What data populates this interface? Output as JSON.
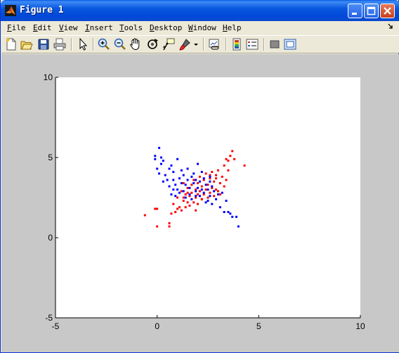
{
  "window": {
    "title": "Figure 1"
  },
  "menu": {
    "items": [
      {
        "label": "File",
        "u": "F",
        "rest": "ile"
      },
      {
        "label": "Edit",
        "u": "E",
        "rest": "dit"
      },
      {
        "label": "View",
        "u": "V",
        "rest": "iew"
      },
      {
        "label": "Insert",
        "u": "I",
        "rest": "nsert"
      },
      {
        "label": "Tools",
        "u": "T",
        "rest": "ools"
      },
      {
        "label": "Desktop",
        "u": "D",
        "rest": "esktop"
      },
      {
        "label": "Window",
        "u": "W",
        "rest": "indow"
      },
      {
        "label": "Help",
        "u": "H",
        "rest": "elp"
      }
    ]
  },
  "toolbar": {
    "icons": [
      "new-figure-icon",
      "open-file-icon",
      "save-icon",
      "print-icon",
      "edit-plot-arrow-icon",
      "zoom-in-icon",
      "zoom-out-icon",
      "pan-hand-icon",
      "rotate-3d-icon",
      "data-cursor-icon",
      "brush-icon",
      "brush-dropdown-icon",
      "link-plot-icon",
      "colorbar-icon",
      "legend-icon",
      "hide-plot-tools-icon",
      "show-plot-tools-icon"
    ]
  },
  "chart_data": {
    "type": "scatter",
    "xlim": [
      -5,
      10
    ],
    "ylim": [
      -5,
      10
    ],
    "xticks": [
      "-5",
      "0",
      "5",
      "10"
    ],
    "yticks": [
      "-5",
      "0",
      "5",
      "10"
    ],
    "series": [
      {
        "color": "#ff0000",
        "marker": "point",
        "x": [
          -0.6,
          -0.1,
          0.0,
          0.0,
          0.6,
          0.6,
          0.7,
          0.8,
          0.9,
          1.0,
          1.0,
          1.1,
          1.2,
          1.2,
          1.3,
          1.3,
          1.4,
          1.4,
          1.5,
          1.5,
          1.5,
          1.6,
          1.6,
          1.7,
          1.7,
          1.8,
          1.8,
          1.9,
          1.9,
          2.0,
          2.0,
          2.0,
          2.1,
          2.1,
          2.2,
          2.2,
          2.3,
          2.3,
          2.4,
          2.4,
          2.5,
          2.5,
          2.6,
          2.6,
          2.7,
          2.7,
          2.8,
          2.8,
          2.9,
          2.9,
          3.0,
          3.0,
          3.1,
          3.1,
          3.2,
          3.3,
          3.3,
          3.4,
          3.4,
          3.5,
          3.5,
          3.6,
          3.7,
          3.8,
          4.3,
          2.2,
          1.9,
          2.6,
          1.3,
          2.9
        ],
        "y": [
          1.4,
          1.8,
          1.8,
          0.7,
          0.7,
          0.9,
          1.5,
          2.1,
          1.6,
          1.8,
          2.5,
          1.9,
          2.9,
          1.7,
          2.3,
          3.4,
          1.9,
          2.7,
          2.2,
          2.8,
          3.1,
          2.0,
          2.6,
          3.3,
          2.8,
          2.2,
          3.6,
          2.5,
          3.0,
          2.1,
          2.7,
          3.4,
          2.9,
          3.8,
          2.4,
          3.2,
          2.7,
          3.6,
          3.0,
          4.0,
          2.5,
          3.3,
          3.7,
          2.8,
          3.1,
          4.1,
          3.5,
          2.6,
          3.9,
          3.0,
          2.9,
          4.2,
          3.4,
          2.7,
          3.8,
          4.5,
          3.2,
          4.9,
          3.6,
          4.2,
          4.8,
          5.1,
          5.4,
          4.9,
          4.5,
          2.4,
          1.7,
          3.9,
          2.5,
          3.7
        ]
      },
      {
        "color": "#0000ff",
        "marker": "point",
        "x": [
          -0.1,
          -0.1,
          0.0,
          0.1,
          0.1,
          0.2,
          0.2,
          0.3,
          0.4,
          0.5,
          0.6,
          0.6,
          0.7,
          0.7,
          0.8,
          0.8,
          0.9,
          0.9,
          1.0,
          1.0,
          1.1,
          1.1,
          1.2,
          1.2,
          1.3,
          1.3,
          1.4,
          1.4,
          1.5,
          1.5,
          1.6,
          1.6,
          1.7,
          1.7,
          1.8,
          1.8,
          1.9,
          1.9,
          2.0,
          2.0,
          2.1,
          2.1,
          2.2,
          2.2,
          2.3,
          2.3,
          2.4,
          2.4,
          2.5,
          2.5,
          2.6,
          2.6,
          2.7,
          2.7,
          2.8,
          2.9,
          3.0,
          3.1,
          3.2,
          3.3,
          3.5,
          3.6,
          3.7,
          3.9,
          4.0,
          0.3,
          0.8,
          1.9,
          2.6,
          3.4
        ],
        "y": [
          5.1,
          4.9,
          4.3,
          5.6,
          4.0,
          5.0,
          4.6,
          4.8,
          3.9,
          3.6,
          4.3,
          3.2,
          4.5,
          2.7,
          3.6,
          4.1,
          3.3,
          2.6,
          4.9,
          3.0,
          3.7,
          2.8,
          4.2,
          3.4,
          2.9,
          3.9,
          3.3,
          2.5,
          4.3,
          3.6,
          3.1,
          2.7,
          3.8,
          2.4,
          3.4,
          4.0,
          2.9,
          3.6,
          3.1,
          4.6,
          3.5,
          2.6,
          4.1,
          3.0,
          2.8,
          3.7,
          2.2,
          3.3,
          3.0,
          2.3,
          2.6,
          3.8,
          2.1,
          3.2,
          2.9,
          2.4,
          2.7,
          1.9,
          2.8,
          1.6,
          1.6,
          1.5,
          1.3,
          1.3,
          0.7,
          3.5,
          3.0,
          2.6,
          3.5,
          2.3
        ]
      }
    ]
  }
}
